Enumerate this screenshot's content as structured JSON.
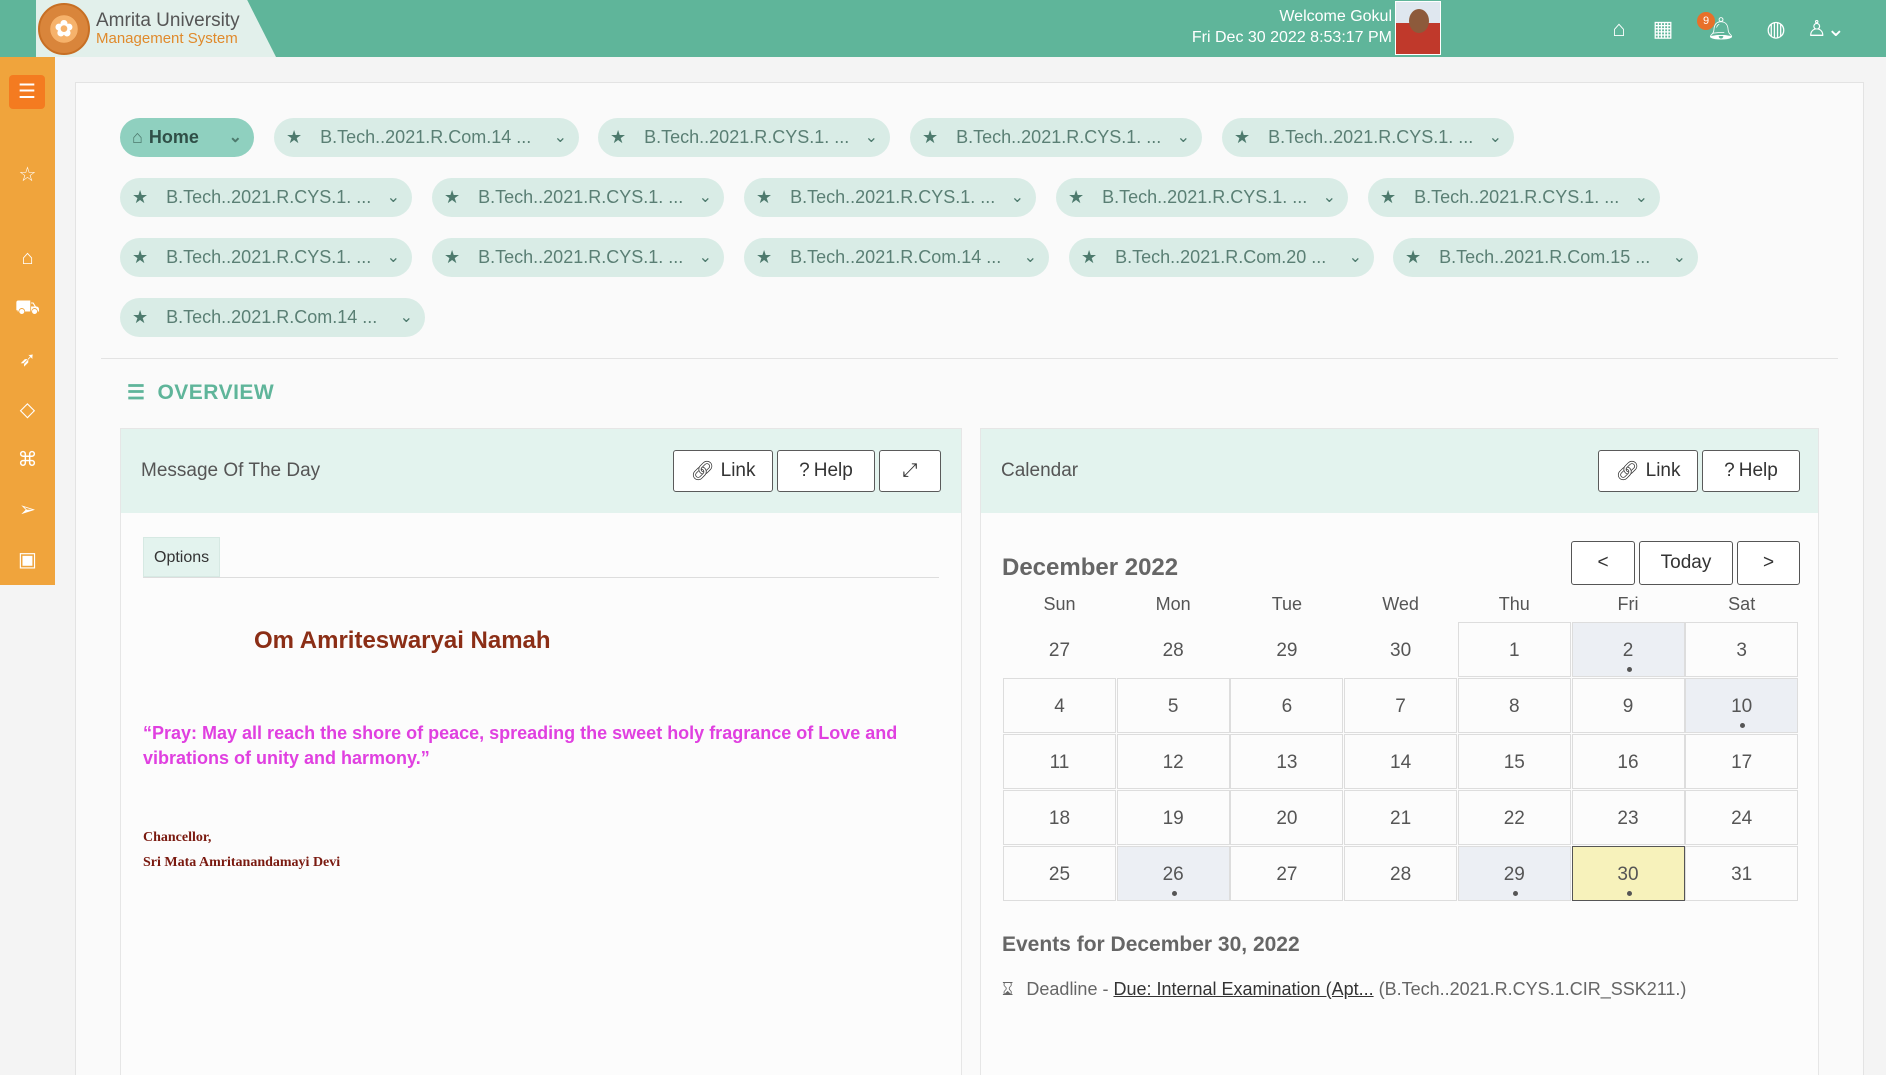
{
  "header": {
    "brand_title": "Amrita University",
    "brand_subtitle": "Management System",
    "welcome": "Welcome Gokul",
    "datetime": "Fri Dec 30 2022 8:53:17 PM",
    "notification_count": "9",
    "icons": [
      "home-icon",
      "apps-grid-icon",
      "bell-icon",
      "globe-icon",
      "user-icon"
    ]
  },
  "sidebar": {
    "icons": [
      "menu-icon",
      "star-icon",
      "home-icon",
      "cart-icon",
      "rocket-icon",
      "diamond-icon",
      "tag-icon",
      "send-icon",
      "briefcase-icon"
    ]
  },
  "chips": [
    {
      "label": "Home"
    },
    {
      "label": "B.Tech..2021.R.Com.14 ..."
    },
    {
      "label": "B.Tech..2021.R.CYS.1. ..."
    },
    {
      "label": "B.Tech..2021.R.CYS.1. ..."
    },
    {
      "label": "B.Tech..2021.R.CYS.1. ..."
    },
    {
      "label": "B.Tech..2021.R.CYS.1. ..."
    },
    {
      "label": "B.Tech..2021.R.CYS.1. ..."
    },
    {
      "label": "B.Tech..2021.R.CYS.1. ..."
    },
    {
      "label": "B.Tech..2021.R.CYS.1. ..."
    },
    {
      "label": "B.Tech..2021.R.CYS.1. ..."
    },
    {
      "label": "B.Tech..2021.R.CYS.1. ..."
    },
    {
      "label": "B.Tech..2021.R.CYS.1. ..."
    },
    {
      "label": "B.Tech..2021.R.Com.14 ..."
    },
    {
      "label": "B.Tech..2021.R.Com.20 ..."
    },
    {
      "label": "B.Tech..2021.R.Com.15 ..."
    },
    {
      "label": "B.Tech..2021.R.Com.14 ..."
    }
  ],
  "overview": {
    "title": "OVERVIEW"
  },
  "motd": {
    "title": "Message Of The Day",
    "link_label": "Link",
    "help_label": "Help",
    "tab_options": "Options",
    "heading": "Om Amriteswaryai Namah",
    "quote": "“Pray: May all reach the shore of peace, spreading the sweet holy fragrance of Love and vibrations of unity and harmony.”",
    "sig_line1": "Chancellor,",
    "sig_line2": "Sri Mata Amritanandamayi Devi"
  },
  "calendar": {
    "title": "Calendar",
    "link_label": "Link",
    "help_label": "Help",
    "month": "December 2022",
    "prev_label": "<",
    "today_label": "Today",
    "next_label": ">",
    "weekdays": [
      "Sun",
      "Mon",
      "Tue",
      "Wed",
      "Thu",
      "Fri",
      "Sat"
    ],
    "weeks": [
      [
        "27",
        "28",
        "29",
        "30",
        "1",
        "2",
        "3"
      ],
      [
        "4",
        "5",
        "6",
        "7",
        "8",
        "9",
        "10"
      ],
      [
        "11",
        "12",
        "13",
        "14",
        "15",
        "16",
        "17"
      ],
      [
        "18",
        "19",
        "20",
        "21",
        "22",
        "23",
        "24"
      ],
      [
        "25",
        "26",
        "27",
        "28",
        "29",
        "30",
        "31"
      ]
    ],
    "event_days": [
      "2",
      "10",
      "26",
      "29",
      "30"
    ],
    "today": "30",
    "events_title": "Events for December 30, 2022",
    "event": {
      "prefix": "Deadline - ",
      "link": "Due: Internal Examination (Apt...",
      "suffix": "(B.Tech..2021.R.CYS.1.CIR_SSK211.)"
    }
  }
}
